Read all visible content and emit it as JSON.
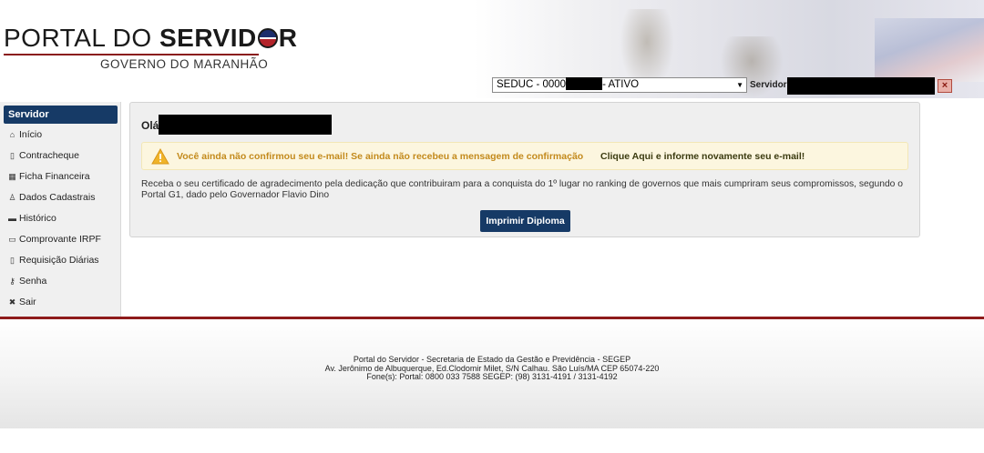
{
  "header": {
    "logo_portal": "PORTAL DO",
    "logo_servidor_a": "SERVID",
    "logo_servidor_b": "R",
    "logo_subtitle": "GOVERNO DO MARANHÃO",
    "unit_select_prefix": "SEDUC - 0000",
    "unit_select_suffix": "- ATIVO",
    "servidor_label": "Servidor",
    "logout_icon": "×"
  },
  "sidebar": {
    "title": "Servidor",
    "items": [
      {
        "icon": "home-icon",
        "glyph": "⌂",
        "label": "Início"
      },
      {
        "icon": "document-icon",
        "glyph": "▯",
        "label": "Contracheque"
      },
      {
        "icon": "table-icon",
        "glyph": "▦",
        "label": "Ficha Financeira"
      },
      {
        "icon": "user-icon",
        "glyph": "♙",
        "label": "Dados Cadastrais"
      },
      {
        "icon": "folder-icon",
        "glyph": "▬",
        "label": "Histórico"
      },
      {
        "icon": "receipt-icon",
        "glyph": "▭",
        "label": "Comprovante IRPF"
      },
      {
        "icon": "document-icon",
        "glyph": "▯",
        "label": "Requisição Diárias"
      },
      {
        "icon": "key-icon",
        "glyph": "⚷",
        "label": "Senha"
      },
      {
        "icon": "close-icon",
        "glyph": "✖",
        "label": "Sair"
      }
    ]
  },
  "main": {
    "greeting": "Olá",
    "alert_text": "Você ainda não confirmou seu e-mail! Se ainda não recebeu a mensagem de confirmação",
    "alert_link": "Clique Aqui e informe novamente seu e-mail!",
    "message": "Receba o seu certificado de agradecimento pela dedicação que contribuiram para a conquista do 1º lugar no ranking de governos que mais cumpriram seus compromissos, segundo o Portal G1, dado pelo Governador Flavio Dino",
    "print_button": "Imprimir Diploma"
  },
  "footer": {
    "line1": "Portal do Servidor - Secretaria de Estado da Gestão e Previdência - SEGEP",
    "line2": "Av. Jerônimo de Albuquerque, Ed.Clodomir Milet, S/N Calhau. São Luís/MA CEP 65074-220",
    "line3": "Fone(s): Portal: 0800 033 7588 SEGEP: (98) 3131-4191 / 3131-4192"
  },
  "colors": {
    "brand_navy": "#163a66",
    "footer_line": "#8e1b1b",
    "alert_text": "#c38a1c"
  }
}
